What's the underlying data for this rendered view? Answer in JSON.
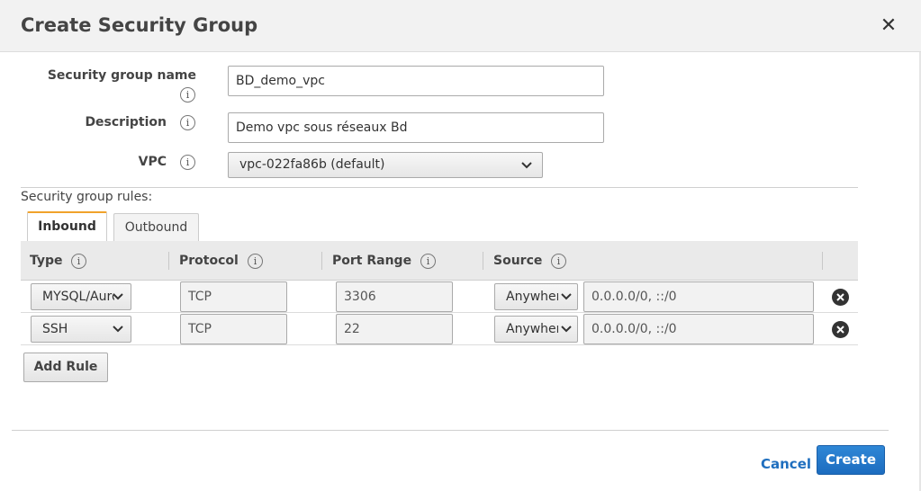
{
  "dialog": {
    "title": "Create Security Group"
  },
  "form": {
    "name_label": "Security group name",
    "name_value": "BD_demo_vpc",
    "description_label": "Description",
    "description_value": "Demo vpc sous réseaux Bd",
    "vpc_label": "VPC",
    "vpc_value": "vpc-022fa86b (default)"
  },
  "rules": {
    "label": "Security group rules:",
    "tabs": [
      {
        "label": "Inbound",
        "active": true
      },
      {
        "label": "Outbound",
        "active": false
      }
    ],
    "columns": [
      "Type",
      "Protocol",
      "Port Range",
      "Source"
    ],
    "rows": [
      {
        "type": "MYSQL/Aurora",
        "protocol": "TCP",
        "port_range": "3306",
        "source_type": "Anywhere",
        "source_value": "0.0.0.0/0, ::/0"
      },
      {
        "type": "SSH",
        "protocol": "TCP",
        "port_range": "22",
        "source_type": "Anywhere",
        "source_value": "0.0.0.0/0, ::/0"
      }
    ],
    "add_rule_label": "Add Rule"
  },
  "footer": {
    "cancel_label": "Cancel",
    "create_label": "Create"
  },
  "icons": {
    "info": "i",
    "close": "✕"
  },
  "colors": {
    "accent": "#1f6fbf",
    "tab_active": "#f0a22b"
  }
}
